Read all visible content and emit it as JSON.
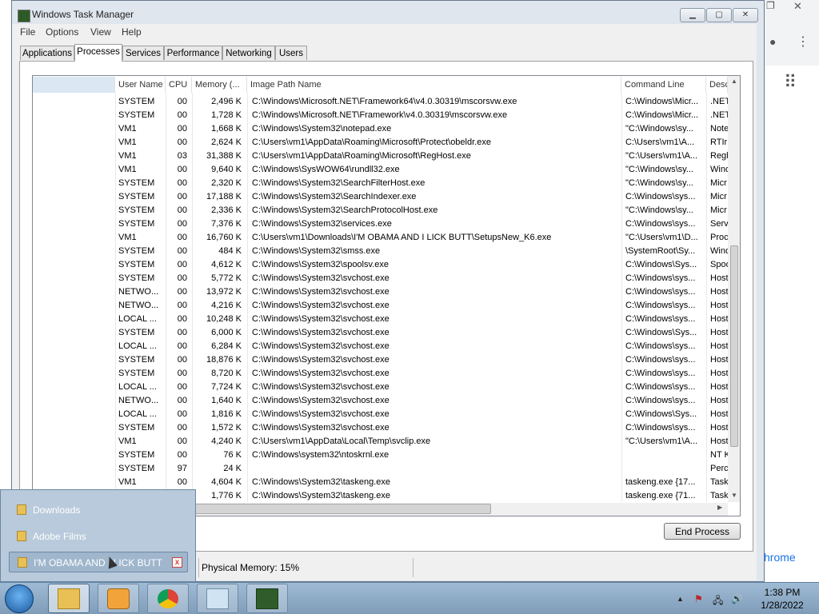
{
  "window": {
    "title": "Windows Task Manager",
    "min_label": "▭",
    "max_label": "▢",
    "close_label": "✕"
  },
  "menu": [
    "File",
    "Options",
    "View",
    "Help"
  ],
  "tabs": [
    "Applications",
    "Processes",
    "Services",
    "Performance",
    "Networking",
    "Users"
  ],
  "active_tab": "Processes",
  "columns": [
    "User Name",
    "CPU",
    "Memory (...",
    "Image Path Name",
    "Command Line",
    "Desc"
  ],
  "rows": [
    [
      "SYSTEM",
      "00",
      "2,496 K",
      "C:\\Windows\\Microsoft.NET\\Framework64\\v4.0.30319\\mscorsvw.exe",
      "C:\\Windows\\Micr...",
      ".NET"
    ],
    [
      "SYSTEM",
      "00",
      "1,728 K",
      "C:\\Windows\\Microsoft.NET\\Framework\\v4.0.30319\\mscorsvw.exe",
      "C:\\Windows\\Micr...",
      ".NET"
    ],
    [
      "VM1",
      "00",
      "1,668 K",
      "C:\\Windows\\System32\\notepad.exe",
      "\"C:\\Windows\\sy...",
      "Note"
    ],
    [
      "VM1",
      "00",
      "2,624 K",
      "C:\\Users\\vm1\\AppData\\Roaming\\Microsoft\\Protect\\obeldr.exe",
      "C:\\Users\\vm1\\A...",
      "RTIr"
    ],
    [
      "VM1",
      "03",
      "31,388 K",
      "C:\\Users\\vm1\\AppData\\Roaming\\Microsoft\\RegHost.exe",
      "\"C:\\Users\\vm1\\A...",
      "Regh"
    ],
    [
      "VM1",
      "00",
      "9,640 K",
      "C:\\Windows\\SysWOW64\\rundll32.exe",
      "\"C:\\Windows\\sy...",
      "Wind"
    ],
    [
      "SYSTEM",
      "00",
      "2,320 K",
      "C:\\Windows\\System32\\SearchFilterHost.exe",
      "\"C:\\Windows\\sy...",
      "Micr"
    ],
    [
      "SYSTEM",
      "00",
      "17,188 K",
      "C:\\Windows\\System32\\SearchIndexer.exe",
      "C:\\Windows\\sys...",
      "Micr"
    ],
    [
      "SYSTEM",
      "00",
      "2,336 K",
      "C:\\Windows\\System32\\SearchProtocolHost.exe",
      "\"C:\\Windows\\sy...",
      "Micr"
    ],
    [
      "SYSTEM",
      "00",
      "7,376 K",
      "C:\\Windows\\System32\\services.exe",
      "C:\\Windows\\sys...",
      "Serv"
    ],
    [
      "VM1",
      "00",
      "16,760 K",
      "C:\\Users\\vm1\\Downloads\\I'M OBAMA AND I LICK BUTT\\SetupsNew_K6.exe",
      "\"C:\\Users\\vm1\\D...",
      "Proc"
    ],
    [
      "SYSTEM",
      "00",
      "484 K",
      "C:\\Windows\\System32\\smss.exe",
      "\\SystemRoot\\Sy...",
      "Wind"
    ],
    [
      "SYSTEM",
      "00",
      "4,612 K",
      "C:\\Windows\\System32\\spoolsv.exe",
      "C:\\Windows\\Sys...",
      "Spoo"
    ],
    [
      "SYSTEM",
      "00",
      "5,772 K",
      "C:\\Windows\\System32\\svchost.exe",
      "C:\\Windows\\sys...",
      "Host"
    ],
    [
      "NETWO...",
      "00",
      "13,972 K",
      "C:\\Windows\\System32\\svchost.exe",
      "C:\\Windows\\sys...",
      "Host"
    ],
    [
      "NETWO...",
      "00",
      "4,216 K",
      "C:\\Windows\\System32\\svchost.exe",
      "C:\\Windows\\sys...",
      "Host"
    ],
    [
      "LOCAL ...",
      "00",
      "10,248 K",
      "C:\\Windows\\System32\\svchost.exe",
      "C:\\Windows\\sys...",
      "Host"
    ],
    [
      "SYSTEM",
      "00",
      "6,000 K",
      "C:\\Windows\\System32\\svchost.exe",
      "C:\\Windows\\Sys...",
      "Host"
    ],
    [
      "LOCAL ...",
      "00",
      "6,284 K",
      "C:\\Windows\\System32\\svchost.exe",
      "C:\\Windows\\sys...",
      "Host"
    ],
    [
      "SYSTEM",
      "00",
      "18,876 K",
      "C:\\Windows\\System32\\svchost.exe",
      "C:\\Windows\\sys...",
      "Host"
    ],
    [
      "SYSTEM",
      "00",
      "8,720 K",
      "C:\\Windows\\System32\\svchost.exe",
      "C:\\Windows\\sys...",
      "Host"
    ],
    [
      "LOCAL ...",
      "00",
      "7,724 K",
      "C:\\Windows\\System32\\svchost.exe",
      "C:\\Windows\\sys...",
      "Host"
    ],
    [
      "NETWO...",
      "00",
      "1,640 K",
      "C:\\Windows\\System32\\svchost.exe",
      "C:\\Windows\\sys...",
      "Host"
    ],
    [
      "LOCAL ...",
      "00",
      "1,816 K",
      "C:\\Windows\\System32\\svchost.exe",
      "C:\\Windows\\Sys...",
      "Host"
    ],
    [
      "SYSTEM",
      "00",
      "1,572 K",
      "C:\\Windows\\System32\\svchost.exe",
      "C:\\Windows\\sys...",
      "Host"
    ],
    [
      "VM1",
      "00",
      "4,240 K",
      "C:\\Users\\vm1\\AppData\\Local\\Temp\\svclip.exe",
      "\"C:\\Users\\vm1\\A...",
      "Host"
    ],
    [
      "SYSTEM",
      "00",
      "76 K",
      "C:\\Windows\\system32\\ntoskrnl.exe",
      "",
      "NT K"
    ],
    [
      "SYSTEM",
      "97",
      "24 K",
      "",
      "",
      "Perc"
    ],
    [
      "VM1",
      "00",
      "4,604 K",
      "C:\\Windows\\System32\\taskeng.exe",
      "taskeng.exe {17...",
      "Task"
    ],
    [
      "",
      "00",
      "1,776 K",
      "C:\\Windows\\System32\\taskeng.exe",
      "taskeng.exe {71...",
      "Task"
    ]
  ],
  "end_process_label": "End Process",
  "status": {
    "physical_memory": "Physical Memory: 15%"
  },
  "jumplist": {
    "items": [
      "Downloads",
      "Adobe Films",
      "I'M OBAMA AND I LICK BUTT"
    ],
    "close_label": "x"
  },
  "browser": {
    "partial_text": "hrome",
    "apps_icon": "⠿",
    "menu_icon": "⋮",
    "account_icon": "●"
  },
  "clock": {
    "time": "1:38 PM",
    "date": "1/28/2022"
  },
  "tray_icons": [
    "▲",
    "⚑",
    "🖧",
    "🔊"
  ]
}
